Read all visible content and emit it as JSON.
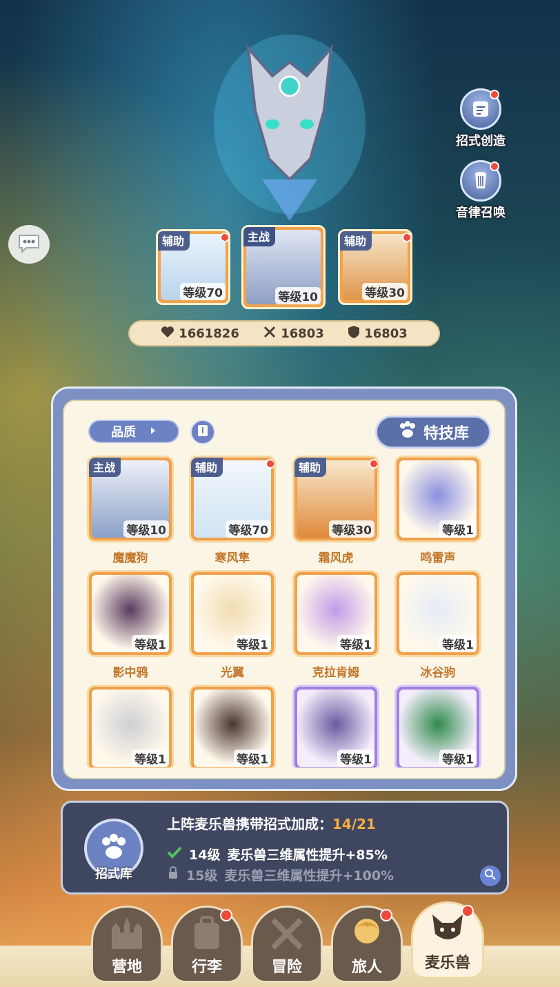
{
  "side_menu": {
    "skill_create": "招式创造",
    "rhythm_summon": "音律召唤"
  },
  "team": [
    {
      "role": "辅助",
      "level": "等级70",
      "creature": "寒风隼",
      "red_dot": true
    },
    {
      "role": "主战",
      "level": "等级10",
      "creature": "魔魔狗",
      "red_dot": false
    },
    {
      "role": "辅助",
      "level": "等级30",
      "creature": "霜风虎",
      "red_dot": true
    }
  ],
  "stats": {
    "hp": "1661826",
    "attack": "16803",
    "defense": "16803"
  },
  "filter": {
    "quality_label": "品质"
  },
  "skill_library_button": "特技库",
  "creatures": [
    {
      "name": "魔魔狗",
      "level": "等级10",
      "tag": "主战",
      "color": "#8aa0c8"
    },
    {
      "name": "寒风隼",
      "level": "等级70",
      "tag": "辅助",
      "color": "#cfe3f2"
    },
    {
      "name": "霜风虎",
      "level": "等级30",
      "tag": "辅助",
      "color": "#e08a3c"
    },
    {
      "name": "鸣雷声",
      "level": "等级1",
      "tag": "",
      "color": "#5a5fb8"
    },
    {
      "name": "影中鸦",
      "level": "等级1",
      "tag": "",
      "color": "#3a2a3e"
    },
    {
      "name": "光翼",
      "level": "等级1",
      "tag": "",
      "color": "#e9d3a6"
    },
    {
      "name": "克拉肯姆",
      "level": "等级1",
      "tag": "",
      "color": "#b58be0"
    },
    {
      "name": "冰谷驹",
      "level": "等级1",
      "tag": "",
      "color": "#dfe6f4"
    },
    {
      "name": "",
      "level": "等级1",
      "tag": "",
      "color": "#d9d9dc"
    },
    {
      "name": "",
      "level": "等级1",
      "tag": "",
      "color": "#3a2b26"
    },
    {
      "name": "",
      "level": "等级1",
      "tag": "",
      "color": "#5a4a8e"
    },
    {
      "name": "",
      "level": "等级1",
      "tag": "",
      "color": "#2f8a4a"
    }
  ],
  "bonus": {
    "title": "上阵麦乐兽携带招式加成：",
    "progress": "14/21",
    "lib_label": "招式库",
    "lines": [
      {
        "level": "14级",
        "text": "麦乐兽三维属性提升+85%",
        "unlocked": true
      },
      {
        "level": "15级",
        "text": "麦乐兽三维属性提升+100%",
        "unlocked": false
      }
    ]
  },
  "nav": [
    {
      "label": "营地",
      "red_dot": false,
      "active": false
    },
    {
      "label": "行李",
      "red_dot": true,
      "active": false
    },
    {
      "label": "冒险",
      "red_dot": false,
      "active": false
    },
    {
      "label": "旅人",
      "red_dot": true,
      "active": false
    },
    {
      "label": "麦乐兽",
      "red_dot": true,
      "active": true
    }
  ],
  "colors": {
    "accent_orange": "#f5b042",
    "panel_blue": "#7d90c4",
    "red_dot": "#f04a3a"
  }
}
